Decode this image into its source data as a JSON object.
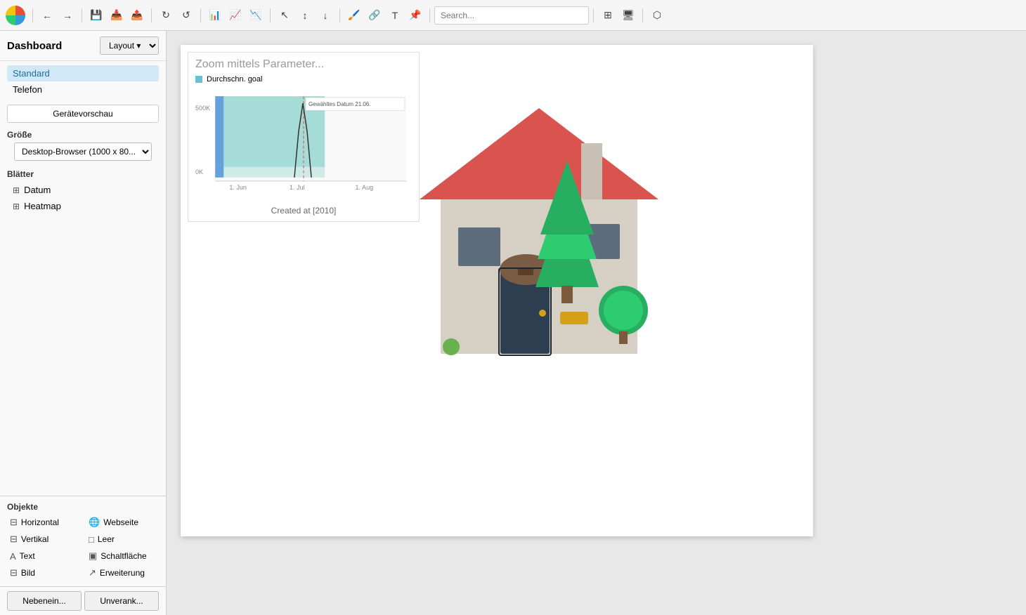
{
  "toolbar": {
    "search_placeholder": "Search..."
  },
  "sidebar": {
    "title": "Dashboard",
    "layout_label": "Layout",
    "devices": [
      "Standard",
      "Telefon"
    ],
    "active_device": "Standard",
    "preview_btn": "Gerätevorschau",
    "size_label": "Größe",
    "size_option": "Desktop-Browser (1000 x 80...",
    "sheets_label": "Blätter",
    "sheets": [
      {
        "name": "Datum",
        "icon": "⊞"
      },
      {
        "name": "Heatmap",
        "icon": "⊞"
      }
    ],
    "objects_label": "Objekte",
    "objects": [
      {
        "name": "Horizontal",
        "icon": "⊟",
        "col": 0
      },
      {
        "name": "Webseite",
        "icon": "🌐",
        "col": 1
      },
      {
        "name": "Vertikal",
        "icon": "⊟",
        "col": 0
      },
      {
        "name": "Leer",
        "icon": "□",
        "col": 1
      },
      {
        "name": "Text",
        "icon": "A",
        "col": 0
      },
      {
        "name": "Schaltfläche",
        "icon": "▣",
        "col": 1
      },
      {
        "name": "Bild",
        "icon": "⊟",
        "col": 0
      },
      {
        "name": "Erweiterung",
        "icon": "↗",
        "col": 1
      }
    ],
    "btn_nebenein": "Nebenein...",
    "btn_unverank": "Unverank..."
  },
  "chart": {
    "title": "Zoom mittels Parameter...",
    "legend_label": "Durchschn. goal",
    "legend_color_1": "#6bbfd6",
    "legend_color_2": "#4a90d9",
    "y_labels": [
      "500K",
      "0K"
    ],
    "x_labels": [
      "1. Jun",
      "1. Jul",
      "1. Aug"
    ],
    "tooltip_label": "Gewähltes Datum 21.06.",
    "created_label": "Created at [2010]"
  }
}
